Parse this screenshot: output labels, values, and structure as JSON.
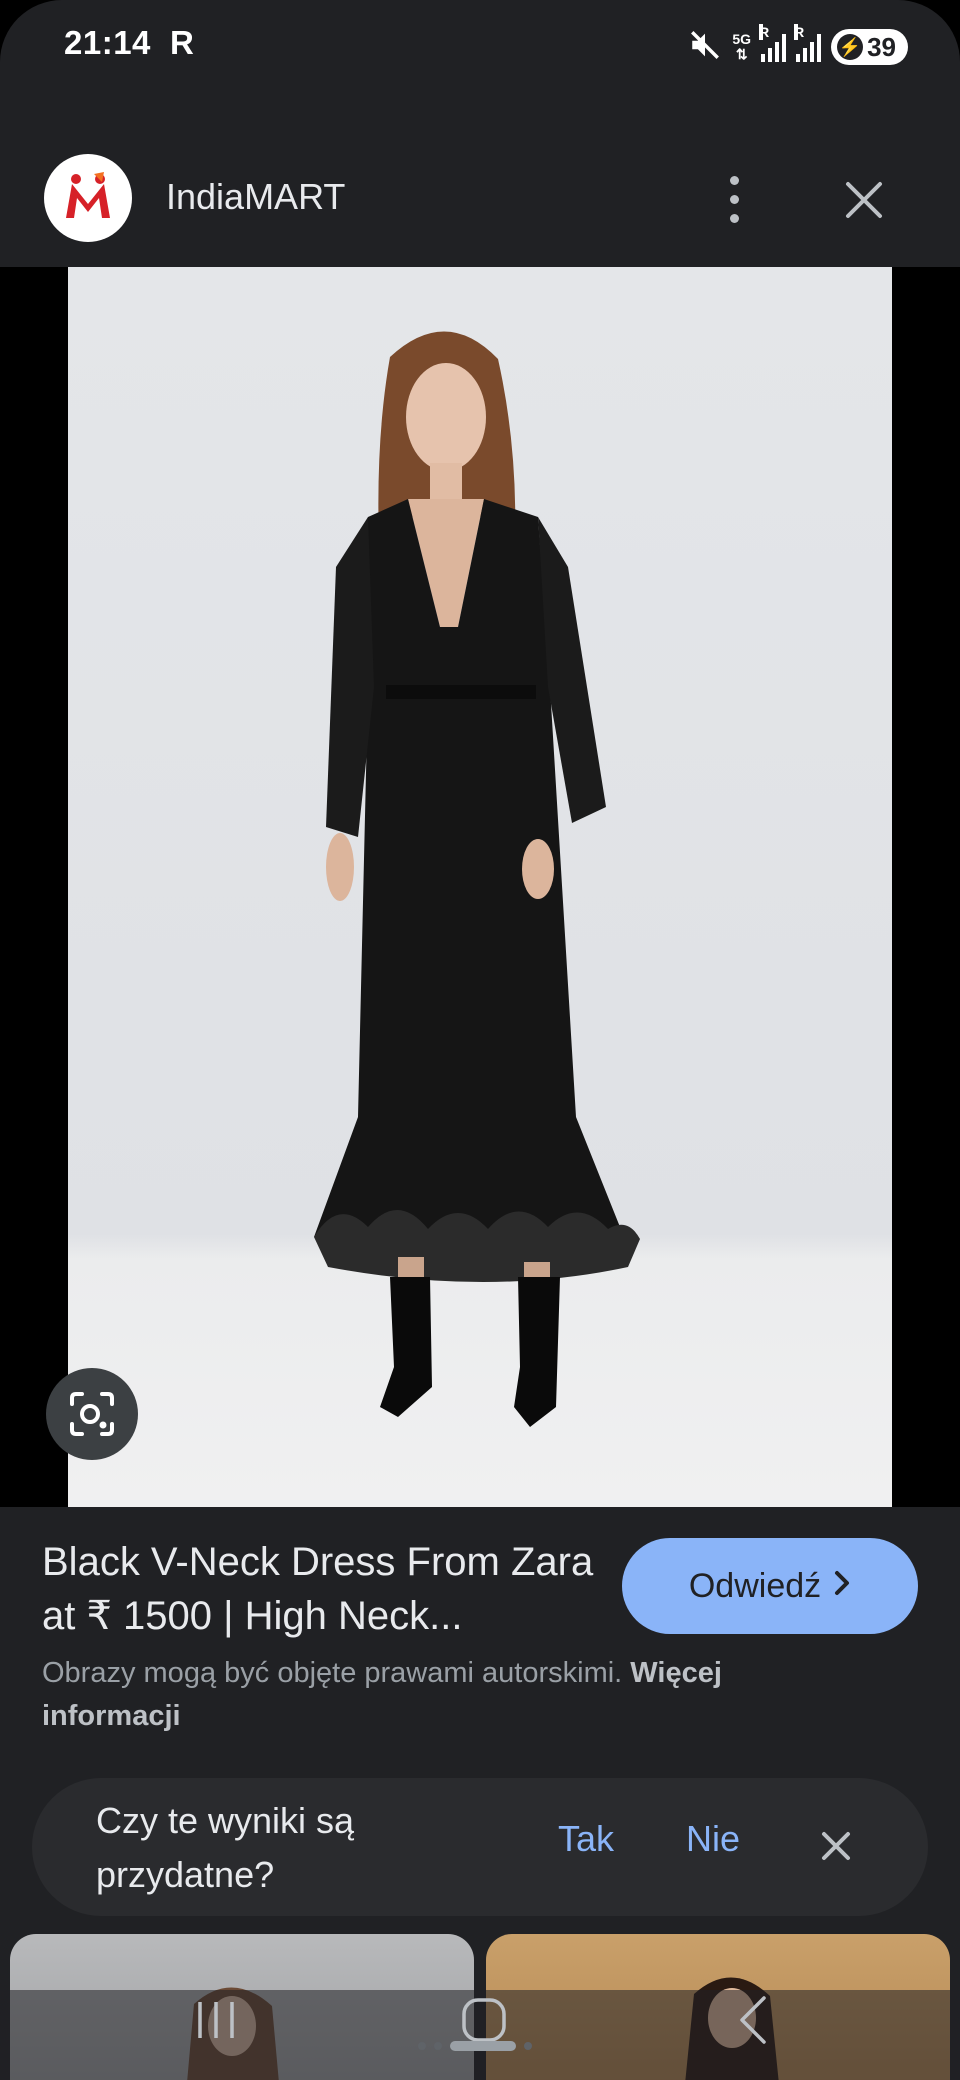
{
  "status_bar": {
    "time": "21:14",
    "carrier_indicator": "R",
    "network": "5G",
    "battery_level": "39",
    "icons": [
      "mute-icon",
      "5g-icon",
      "signal-icon",
      "signal-icon",
      "battery-charging-icon"
    ]
  },
  "header": {
    "site_name": "IndiaMART",
    "logo_icon": "indiamart-logo",
    "menu_icon": "more-vert-icon",
    "close_icon": "close-icon"
  },
  "image": {
    "lens_icon": "google-lens-icon"
  },
  "result": {
    "title": "Black V-Neck Dress From Zara at ₹ 1500 | High Neck...",
    "visit_label": "Odwiedź",
    "visit_icon": "chevron-right-icon",
    "copyright_text": "Obrazy mogą być objęte prawami autorskimi.",
    "more_info_label": "Więcej informacji"
  },
  "feedback": {
    "question": "Czy te wyniki są przydatne?",
    "yes_label": "Tak",
    "no_label": "Nie",
    "close_icon": "close-icon"
  },
  "colors": {
    "background": "#202124",
    "accent": "#8ab4f8",
    "text_primary": "#e8eaed",
    "text_secondary": "#9aa0a6"
  },
  "nav": {
    "icons": [
      "recent-apps-icon",
      "home-icon",
      "back-icon"
    ]
  }
}
